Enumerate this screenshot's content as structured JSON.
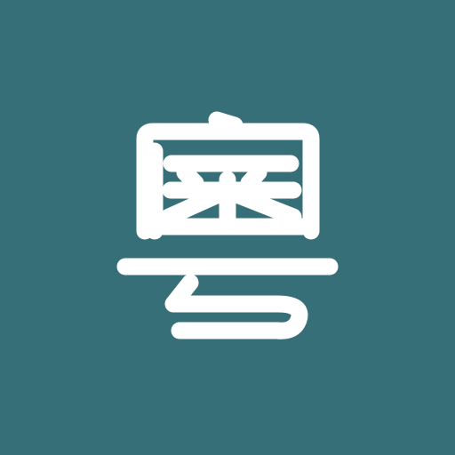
{
  "icon": {
    "name": "yue-character-app-icon",
    "glyph": "粵",
    "background_color": "#376f79",
    "foreground_color": "#ffffff"
  }
}
